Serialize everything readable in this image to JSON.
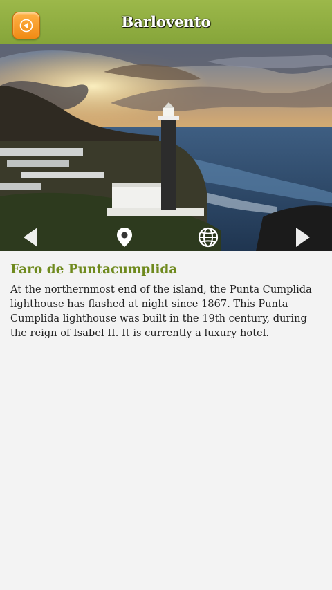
{
  "header": {
    "title": "Barlovento",
    "back_icon": "back-arrow-icon",
    "accent": "#8fad3f"
  },
  "hero": {
    "image_alt": "Lighthouse on volcanic coast at sunset",
    "nav": {
      "prev_icon": "chevron-left-icon",
      "location_icon": "map-pin-icon",
      "web_icon": "globe-icon",
      "next_icon": "chevron-right-icon"
    }
  },
  "place": {
    "title": "Faro de Puntacumplida",
    "description": "At the northernmost end of the island, the Punta Cumplida lighthouse has flashed at night since 1867. This Punta Cumplida lighthouse was built in the 19th century, during the reign of Isabel II. It is currently a luxury hotel.",
    "title_color": "#6f8a1e"
  }
}
